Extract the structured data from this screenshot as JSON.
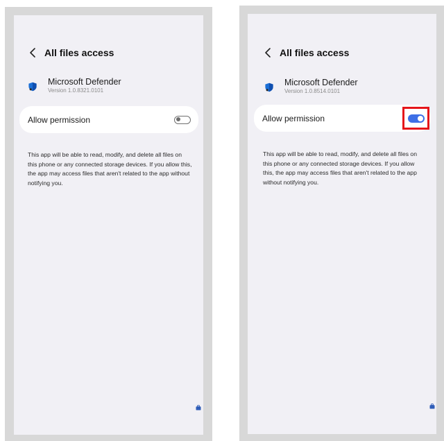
{
  "screens": [
    {
      "title": "All files access",
      "app_name": "Microsoft Defender",
      "app_version": "Version 1.0.8321.0101",
      "permission_label": "Allow permission",
      "permission_enabled": false,
      "description": "This app will be able to read, modify, and delete all files on this phone or any connected storage devices. If you allow this, the app may access files that aren't related to the app without notifying you."
    },
    {
      "title": "All files access",
      "app_name": "Microsoft Defender",
      "app_version": "Version 1.0.8514.0101",
      "permission_label": "Allow permission",
      "permission_enabled": true,
      "description": "This app will be able to read, modify, and delete all files on this phone or any connected storage devices. If you allow this, the app may access files that aren't related to the app without notifying you."
    }
  ],
  "colors": {
    "toggle_on": "#3e6fe6",
    "toggle_off": "#6e6e6e",
    "highlight": "#e5151a",
    "screen_background": "#f1f0f5",
    "frame": "#d8d8d8"
  },
  "icons": {
    "back": "chevron-left-icon",
    "app": "defender-shield-icon",
    "floating": "briefcase-icon"
  }
}
